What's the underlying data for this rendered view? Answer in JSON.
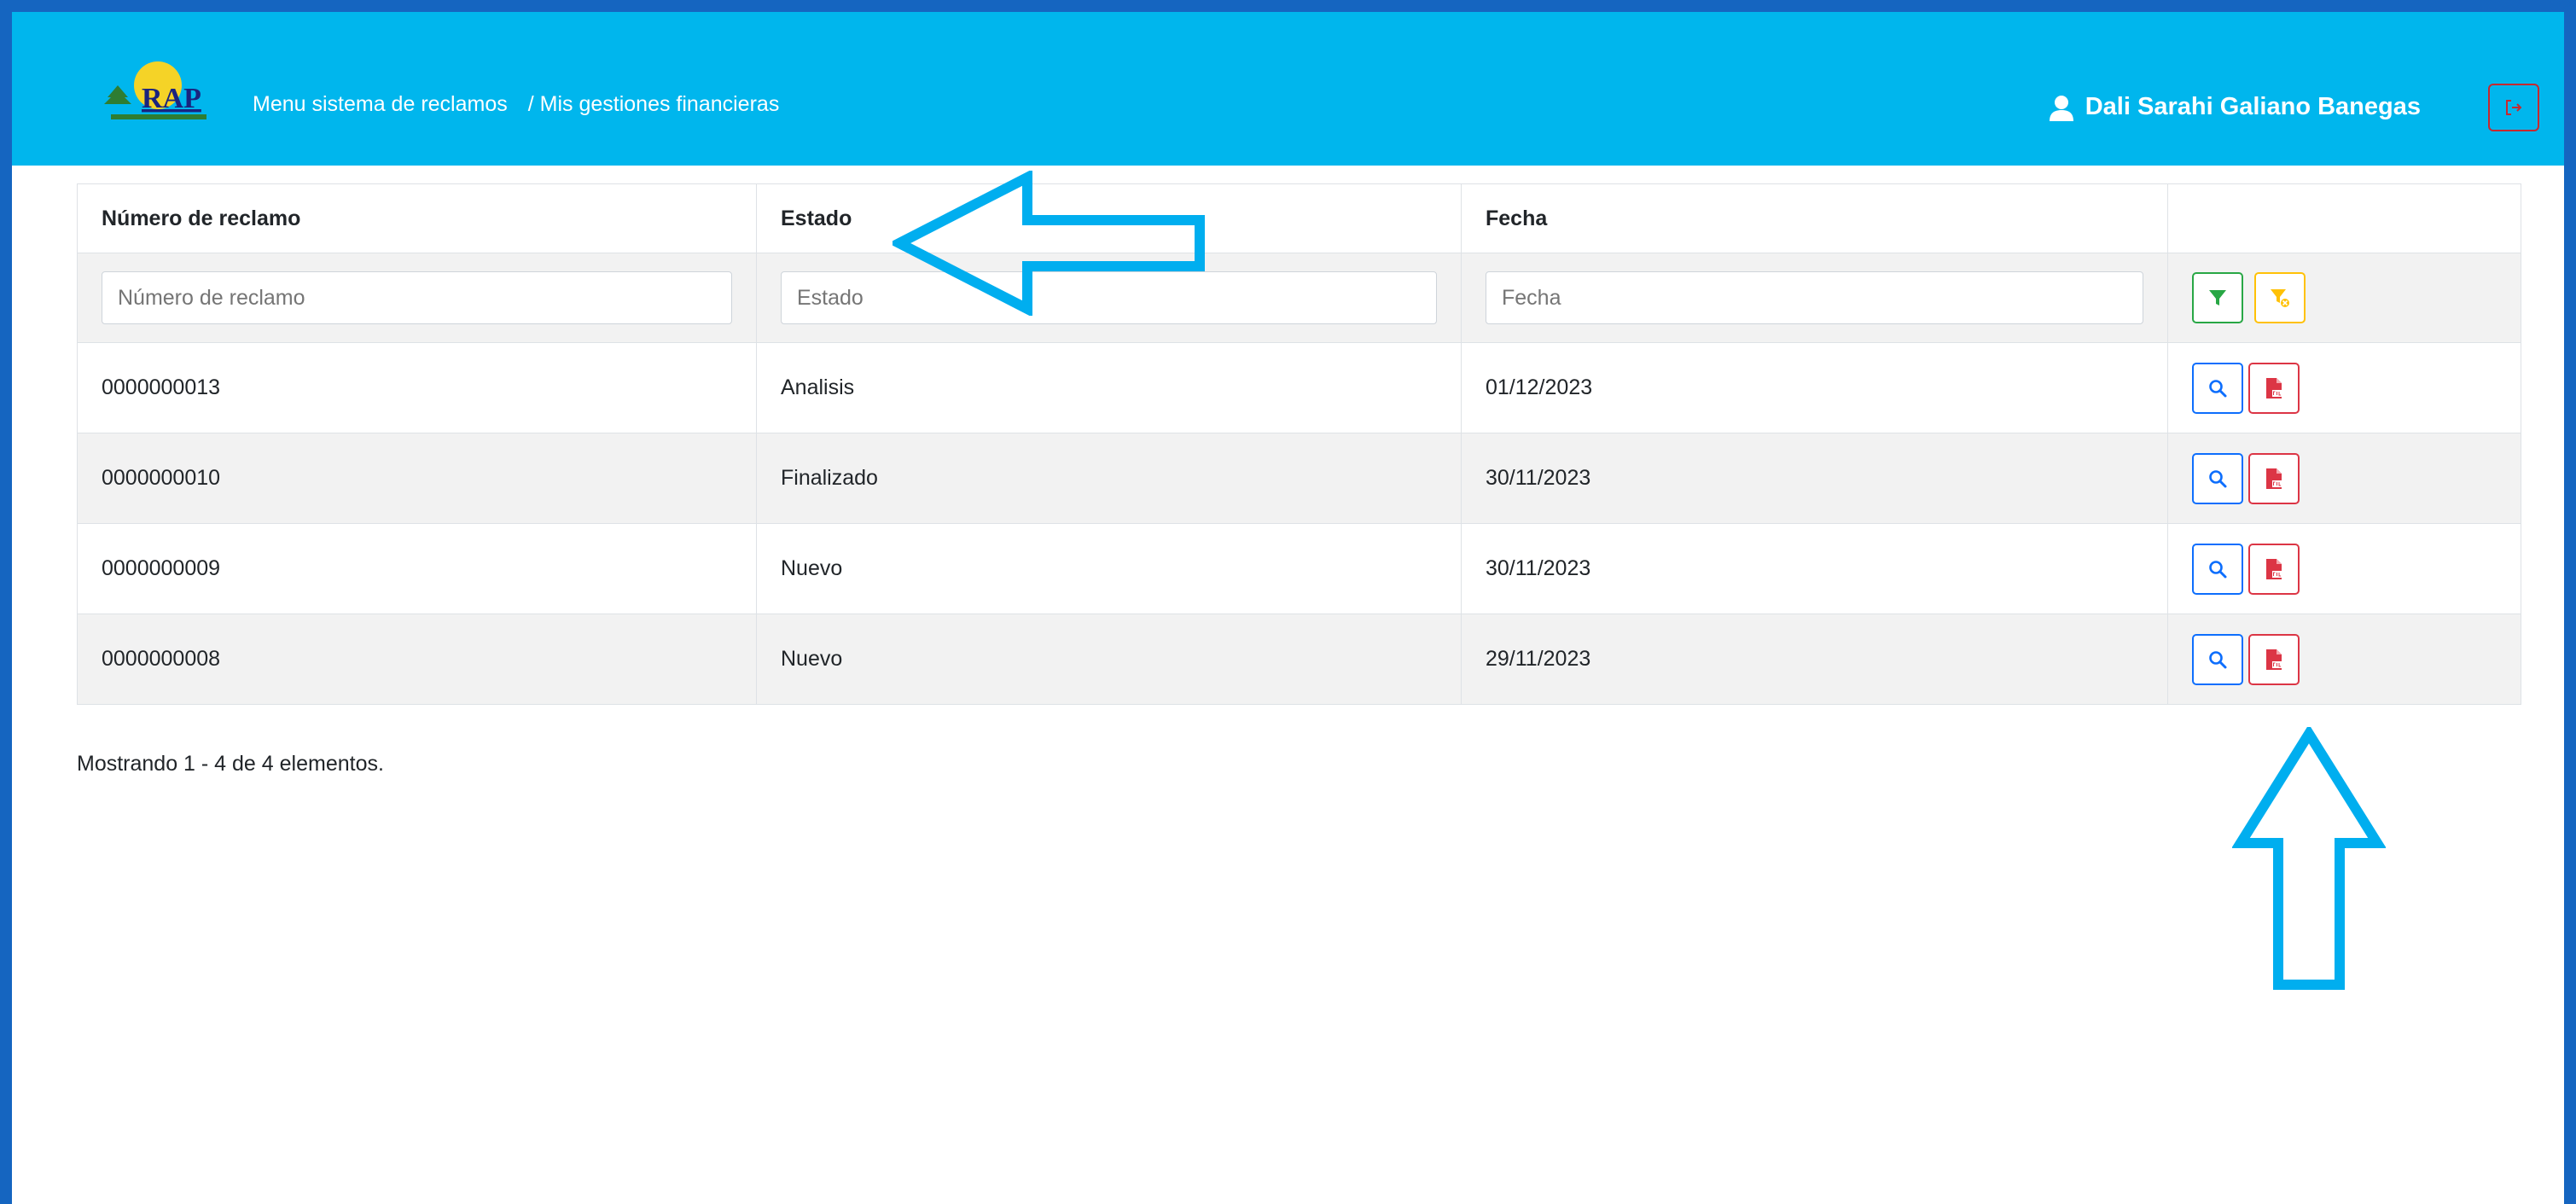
{
  "header": {
    "logo_text": "RAP",
    "breadcrumb_menu": "Menu sistema de reclamos",
    "breadcrumb_current": "/ Mis gestiones financieras",
    "user_name": "Dali Sarahi Galiano Banegas"
  },
  "table": {
    "columns": [
      "Número de reclamo",
      "Estado",
      "Fecha",
      ""
    ],
    "filters": {
      "numero_placeholder": "Número de reclamo",
      "estado_placeholder": "Estado",
      "fecha_placeholder": "Fecha"
    },
    "rows": [
      {
        "numero": "0000000013",
        "estado": "Analisis",
        "fecha": "01/12/2023"
      },
      {
        "numero": "0000000010",
        "estado": "Finalizado",
        "fecha": "30/11/2023"
      },
      {
        "numero": "0000000009",
        "estado": "Nuevo",
        "fecha": "30/11/2023"
      },
      {
        "numero": "0000000008",
        "estado": "Nuevo",
        "fecha": "29/11/2023"
      }
    ]
  },
  "summary": "Mostrando 1 - 4 de 4 elementos.",
  "icons": {
    "filter": "filter-icon",
    "clear_filter": "filter-clear-icon",
    "view": "search-icon",
    "pdf": "pdf-icon",
    "logout": "logout-icon",
    "user": "user-icon"
  },
  "colors": {
    "navbar": "#00b6ed",
    "frame": "#1565c0",
    "annotation_arrow": "#00aeef",
    "filter_button": "#28a745",
    "clear_button": "#ffc107",
    "view_button": "#0d6efd",
    "pdf_button": "#dc3545"
  }
}
